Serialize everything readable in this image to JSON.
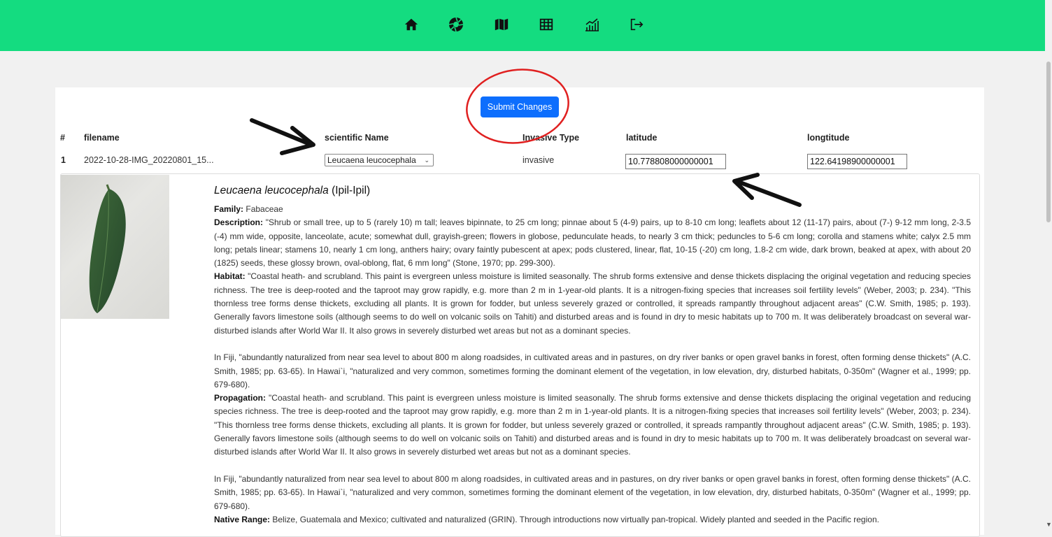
{
  "nav": {
    "icons": [
      "home-icon",
      "aperture-icon",
      "map-icon",
      "table-icon",
      "chart-icon",
      "logout-icon"
    ],
    "accent_color": "#14dc80"
  },
  "actions": {
    "submit_label": "Submit Changes",
    "submit_color": "#0d6efd"
  },
  "table": {
    "headers": {
      "index": "#",
      "filename": "filename",
      "scientific_name": "scientific Name",
      "invasive_type": "Invasive Type",
      "latitude": "latitude",
      "longitude": "longtitude"
    },
    "row": {
      "index": "1",
      "filename": "2022-10-28-IMG_20220801_15...",
      "scientific_name": "Leucaena leucocephala",
      "invasive_type": "invasive",
      "latitude": "10.778808000000001",
      "longitude": "122.64198900000001"
    }
  },
  "species": {
    "scientific": "Leucaena leucocephala",
    "common": "(Ipil-Ipil)",
    "family_label": "Family:",
    "family": "Fabaceae",
    "description_label": "Description:",
    "description": "\"Shrub or small tree, up to 5 (rarely 10) m tall; leaves bipinnate, to 25 cm long; pinnae about 5 (4-9) pairs, up to 8-10 cm long; leaflets about 12 (11-17) pairs, about (7-) 9-12 mm long, 2-3.5 (-4) mm wide, opposite, lanceolate, acute; somewhat dull, grayish-green; flowers in globose, pedunculate heads, to nearly 3 cm thick; peduncles to 5-6 cm long; corolla and stamens white; calyx 2.5 mm long; petals linear; stamens 10, nearly 1 cm long, anthers hairy; ovary faintly pubescent at apex; pods clustered, linear, flat, 10-15 (-20) cm long, 1.8-2 cm wide, dark brown, beaked at apex, with about 20 (1825) seeds, these glossy brown, oval-oblong, flat, 6 mm long\" (Stone, 1970; pp. 299-300).",
    "habitat_label": "Habitat:",
    "habitat": "\"Coastal heath- and scrubland. This paint is evergreen unless moisture is limited seasonally. The shrub forms extensive and dense thickets displacing the original vegetation and reducing species richness. The tree is deep-rooted and the taproot may grow rapidly, e.g. more than 2 m in 1-year-old plants. It is a nitrogen-fixing species that increases soil fertility levels\" (Weber, 2003; p. 234). \"This thornless tree forms dense thickets, excluding all plants. It is grown for fodder, but unless severely grazed or controlled, it spreads rampantly throughout adjacent areas\" (C.W. Smith, 1985; p. 193). Generally favors limestone soils (although seems to do well on volcanic soils on Tahiti) and disturbed areas and is found in dry to mesic habitats up to 700 m. It was deliberately broadcast on several war-disturbed islands after World War II. It also grows in severely disturbed wet areas but not as a dominant species.",
    "fiji_note": "In Fiji, \"abundantly naturalized from near sea level to about 800 m along roadsides, in cultivated areas and in pastures, on dry river banks or open gravel banks in forest, often forming dense thickets\" (A.C. Smith, 1985; pp. 63-65). In Hawai`i, \"naturalized and very common, sometimes forming the dominant element of the vegetation, in low elevation, dry, disturbed habitats, 0-350m\" (Wagner et al., 1999; pp. 679-680).",
    "propagation_label": "Propagation:",
    "propagation": "\"Coastal heath- and scrubland. This paint is evergreen unless moisture is limited seasonally. The shrub forms extensive and dense thickets displacing the original vegetation and reducing species richness. The tree is deep-rooted and the taproot may grow rapidly, e.g. more than 2 m in 1-year-old plants. It is a nitrogen-fixing species that increases soil fertility levels\" (Weber, 2003; p. 234). \"This thornless tree forms dense thickets, excluding all plants. It is grown for fodder, but unless severely grazed or controlled, it spreads rampantly throughout adjacent areas\" (C.W. Smith, 1985; p. 193). Generally favors limestone soils (although seems to do well on volcanic soils on Tahiti) and disturbed areas and is found in dry to mesic habitats up to 700 m. It was deliberately broadcast on several war-disturbed islands after World War II. It also grows in severely disturbed wet areas but not as a dominant species.",
    "fiji_note_2": "In Fiji, \"abundantly naturalized from near sea level to about 800 m along roadsides, in cultivated areas and in pastures, on dry river banks or open gravel banks in forest, often forming dense thickets\" (A.C. Smith, 1985; pp. 63-65). In Hawai`i, \"naturalized and very common, sometimes forming the dominant element of the vegetation, in low elevation, dry, disturbed habitats, 0-350m\" (Wagner et al., 1999; pp. 679-680).",
    "native_range_label": "Native Range:",
    "native_range": "Belize, Guatemala and Mexico; cultivated and naturalized (GRIN). Through introductions now virtually pan-tropical. Widely planted and seeded in the Pacific region."
  }
}
